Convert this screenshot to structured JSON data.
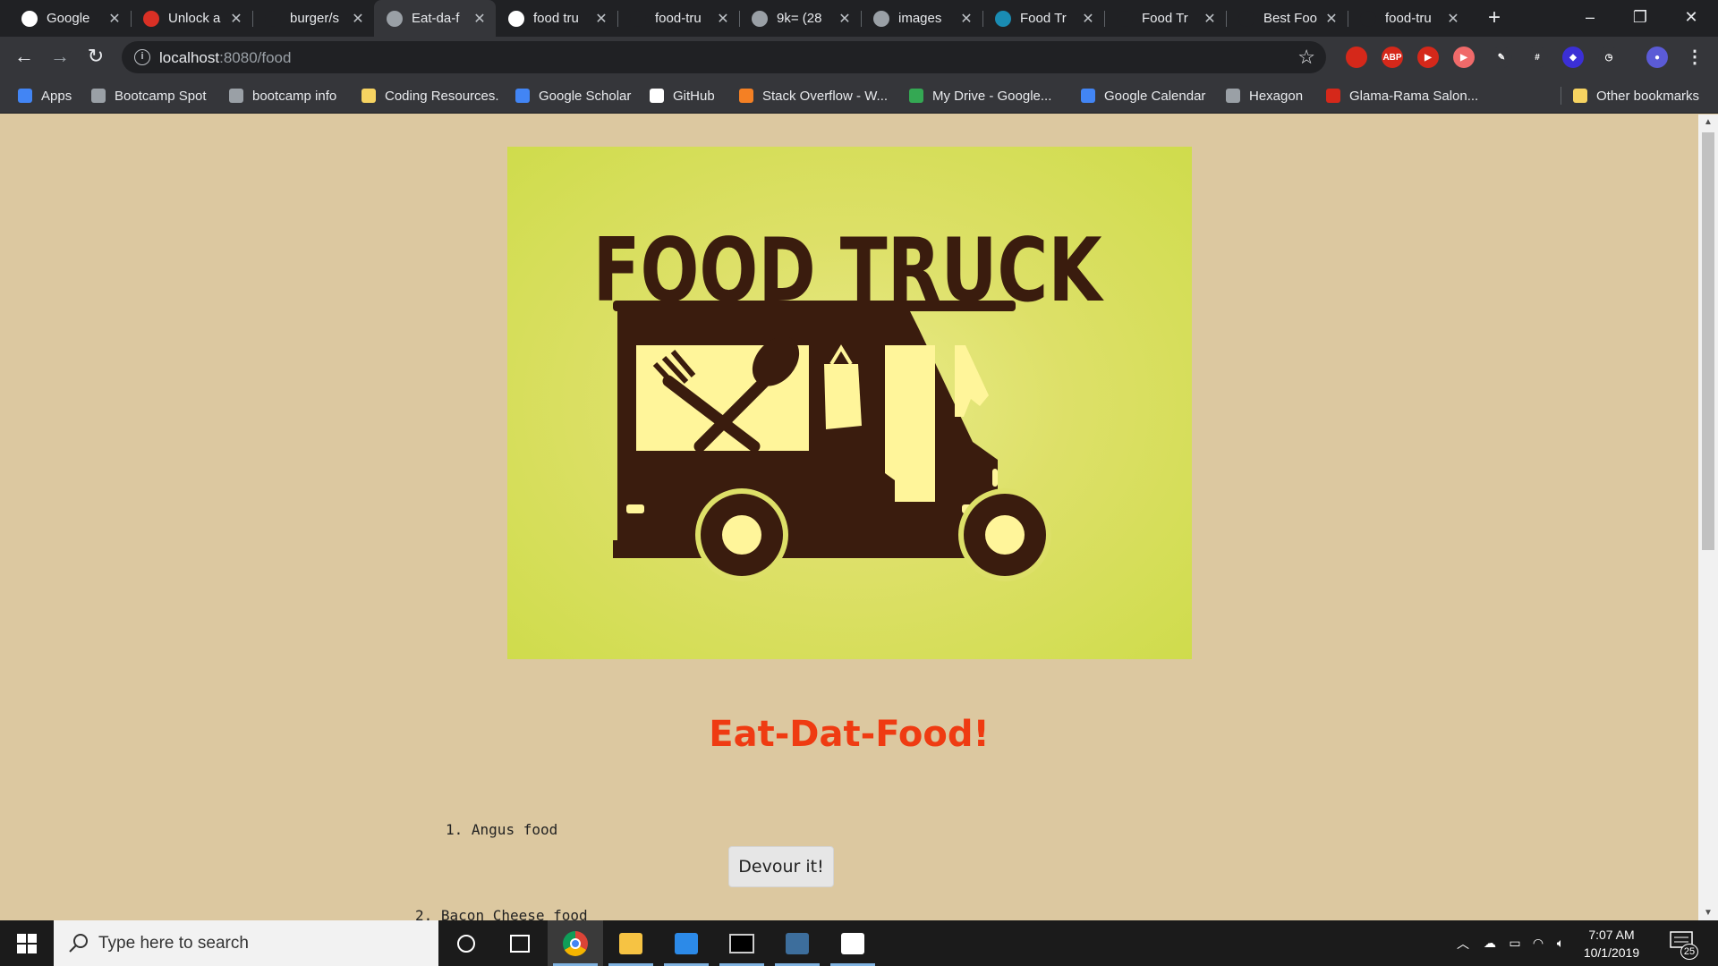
{
  "browser": {
    "tabs": [
      {
        "title": "Google",
        "favicon": "google-icon",
        "color": "#ffffff"
      },
      {
        "title": "Unlock a",
        "favicon": "gmail-icon",
        "color": "#d93025"
      },
      {
        "title": "burger/s",
        "favicon": "github-icon",
        "color": "#202124"
      },
      {
        "title": "Eat-da-f",
        "favicon": "globe-icon",
        "color": "#9aa0a6",
        "active": true
      },
      {
        "title": "food tru",
        "favicon": "google-icon",
        "color": "#ffffff"
      },
      {
        "title": "food-tru",
        "favicon": "blank-icon",
        "color": "#202124"
      },
      {
        "title": "9k= (28",
        "favicon": "globe-icon",
        "color": "#9aa0a6"
      },
      {
        "title": "images",
        "favicon": "globe-icon",
        "color": "#9aa0a6"
      },
      {
        "title": "Food Tr",
        "favicon": "site-icon",
        "color": "#1a8cb3"
      },
      {
        "title": "Food Tr",
        "favicon": "is-icon",
        "color": "#202124"
      },
      {
        "title": "Best Foo",
        "favicon": "is-icon",
        "color": "#202124"
      },
      {
        "title": "food-tru",
        "favicon": "blank-icon",
        "color": "#202124"
      }
    ],
    "new_tab": "+",
    "window_controls": {
      "minimize": "–",
      "restore": "❐",
      "close": "✕"
    },
    "nav": {
      "back": "←",
      "forward": "→",
      "reload": "↻"
    },
    "address": {
      "host": "localhost",
      "path": ":8080/food",
      "info": "i",
      "star": "☆"
    },
    "extensions": [
      {
        "name": "ublock-icon",
        "label": "",
        "color": "#d5281a"
      },
      {
        "name": "abp-icon",
        "label": "ABP",
        "color": "#d5281a"
      },
      {
        "name": "video-ext-icon",
        "label": "▶",
        "color": "#d5281a"
      },
      {
        "name": "screencast-icon",
        "label": "▶",
        "color": "#f06a6a"
      },
      {
        "name": "eyedropper-icon",
        "label": "✎",
        "color": "#35363a"
      },
      {
        "name": "grid-ext-icon",
        "label": "#",
        "color": "#35363a"
      },
      {
        "name": "diamond-ext-icon",
        "label": "◆",
        "color": "#3b2fd6"
      },
      {
        "name": "clock-ext-icon",
        "label": "◷",
        "color": "#35363a"
      },
      {
        "name": "profile-icon",
        "label": "●",
        "color": "#5b5bd6"
      }
    ],
    "menu": "⋮",
    "bookmarks": [
      {
        "label": "Apps",
        "icon": "apps-icon",
        "color": "#4285f4"
      },
      {
        "label": "Bootcamp Spot",
        "icon": "globe-icon",
        "color": "#9aa0a6"
      },
      {
        "label": "bootcamp info",
        "icon": "wordpress-icon",
        "color": "#9aa0a6"
      },
      {
        "label": "Coding Resources.",
        "icon": "folder-icon",
        "color": "#f6d361"
      },
      {
        "label": "Google Scholar",
        "icon": "scholar-icon",
        "color": "#4285f4"
      },
      {
        "label": "GitHub",
        "icon": "github-icon",
        "color": "#ffffff"
      },
      {
        "label": "Stack Overflow - W...",
        "icon": "stackoverflow-icon",
        "color": "#f48024"
      },
      {
        "label": "My Drive - Google...",
        "icon": "drive-icon",
        "color": "#34a853"
      },
      {
        "label": "Google Calendar",
        "icon": "calendar-icon",
        "color": "#4285f4"
      },
      {
        "label": "Hexagon",
        "icon": "hexagon-icon",
        "color": "#9aa0a6"
      },
      {
        "label": "Glama-Rama Salon...",
        "icon": "opera-icon",
        "color": "#d5281a"
      }
    ],
    "other_bookmarks": "Other bookmarks"
  },
  "page": {
    "hero_image_alt": "FOOD TRUCK",
    "title": "Eat-Dat-Food!",
    "foods": [
      {
        "number": "1.",
        "name": "Angus food"
      },
      {
        "number": "2.",
        "name": "Bacon Cheese food"
      }
    ],
    "devour_label": "Devour it!",
    "colors": {
      "background": "#dcc8a0",
      "title": "#ef3b12",
      "hero_bg": "#dde068",
      "truck": "#3a1c0e",
      "truck_window": "#fff59a"
    }
  },
  "taskbar": {
    "search_placeholder": "Type here to search",
    "apps": [
      "cortana-icon",
      "task-view-icon",
      "chrome-icon",
      "file-explorer-icon",
      "vscode-icon",
      "terminal-icon",
      "mysql-workbench-icon",
      "photos-icon"
    ],
    "time": "7:07 AM",
    "date": "10/1/2019",
    "notification_count": "25"
  }
}
